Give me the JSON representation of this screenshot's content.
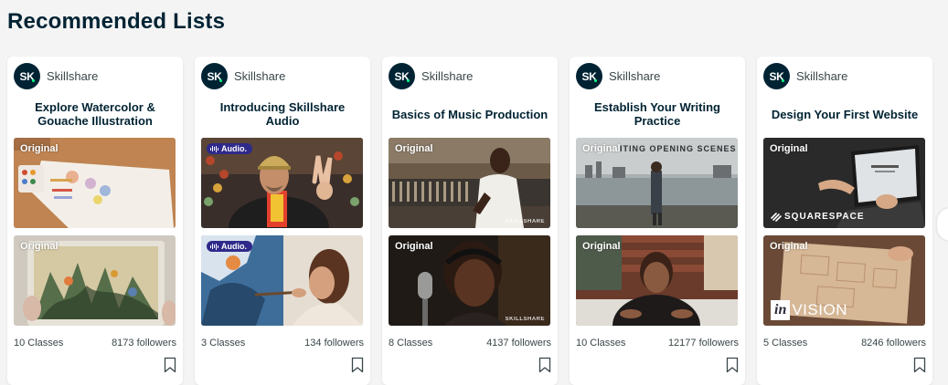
{
  "section_title": "Recommended Lists",
  "colors": {
    "brand_navy": "#002333",
    "brand_green": "#00ff84",
    "audio_badge": "#2f2a8a"
  },
  "cards": [
    {
      "avatar": "SK",
      "brand": "Skillshare",
      "title": "Explore Watercolor & Gouache Illustration",
      "thumb1_badge": "Original",
      "thumb2_badge": "Original",
      "classes": "10 Classes",
      "followers": "8173 followers",
      "bookmark_icon": "bookmark-icon"
    },
    {
      "avatar": "SK",
      "brand": "Skillshare",
      "title": "Introducing Skillshare Audio",
      "thumb1_badge": "Audio.",
      "thumb2_badge": "Audio.",
      "classes": "3 Classes",
      "followers": "134 followers",
      "bookmark_icon": "bookmark-icon"
    },
    {
      "avatar": "SK",
      "brand": "Skillshare",
      "title": "Basics of Music Production",
      "thumb1_badge": "Original",
      "thumb2_badge": "Original",
      "thumb1_watermark": "SKILLSHARE",
      "thumb2_watermark": "SKILLSHARE",
      "classes": "8 Classes",
      "followers": "4137 followers",
      "bookmark_icon": "bookmark-icon"
    },
    {
      "avatar": "SK",
      "brand": "Skillshare",
      "title": "Establish Your Writing Practice",
      "thumb1_badge": "Original",
      "thumb2_badge": "Original",
      "thumb1_overlay": "ITING OPENING SCENES",
      "classes": "10 Classes",
      "followers": "12177 followers",
      "bookmark_icon": "bookmark-icon"
    },
    {
      "avatar": "SK",
      "brand": "Skillshare",
      "title": "Design Your First Website",
      "thumb1_badge": "Original",
      "thumb2_badge": "Original",
      "thumb1_logo": "SQUARESPACE",
      "thumb2_logo_in": "in",
      "thumb2_logo_rest": "VISION",
      "classes": "5 Classes",
      "followers": "8246 followers",
      "bookmark_icon": "bookmark-icon"
    }
  ]
}
